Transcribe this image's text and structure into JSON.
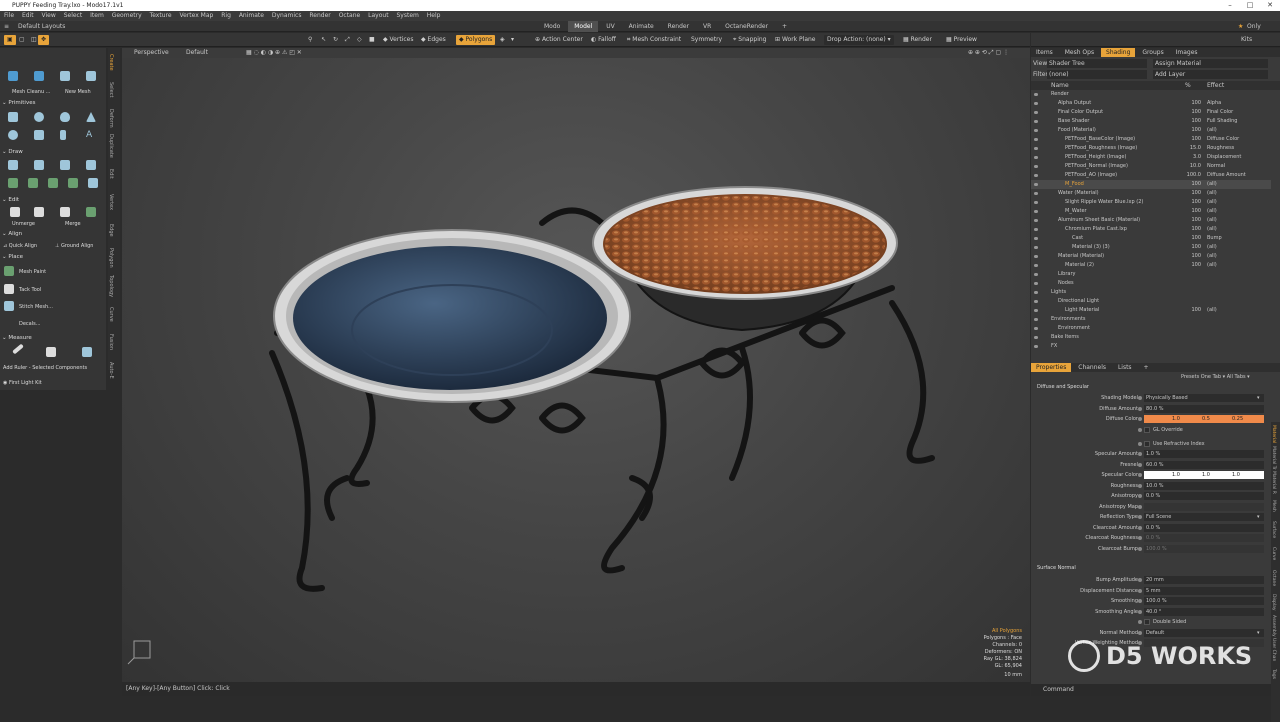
{
  "window": {
    "title": "PUPPY Feeding Tray.lxo - Modo17.1v1"
  },
  "menu": [
    "File",
    "Edit",
    "View",
    "Select",
    "Item",
    "Geometry",
    "Texture",
    "Vertex Map",
    "Rig",
    "Animate",
    "Dynamics",
    "Render",
    "Octane",
    "Layout",
    "System",
    "Help"
  ],
  "layout": {
    "label": "Default Layouts",
    "tabs": [
      "Modo",
      "Model",
      "UV",
      "Animate",
      "Render",
      "VR",
      "OctaneRender"
    ],
    "active_tab": "Model",
    "only_label": "Only",
    "kits_label": "Kits"
  },
  "toolbar": {
    "vertices": "Vertices",
    "edges": "Edges",
    "polygons": "Polygons",
    "action_center": "Action Center",
    "falloff": "Falloff",
    "mesh_constraint": "Mesh Constraint",
    "symmetry": "Symmetry",
    "snapping": "Snapping",
    "work_plane": "Work Plane",
    "drop_action": "Drop Action: (none)",
    "render": "Render",
    "preview": "Preview"
  },
  "left_panel": {
    "mesh_cleanup": "Mesh Cleanu ...",
    "new_mesh": "New Mesh",
    "primitives": "Primitives",
    "draw": "Draw",
    "edit": "Edit",
    "unmerge": "Unmerge",
    "merge": "Merge",
    "align": "Align",
    "quick_align": "Quick Align",
    "ground_align": "Ground Align",
    "place": "Place",
    "mesh_paint": "Mesh Paint",
    "tack_tool": "Tack Tool",
    "stitch_mesh": "Stitch Mesh...",
    "decals": "Decals...",
    "measure": "Measure",
    "add_ruler": "Add Ruler - Selected Components",
    "first_light_kit": "First Light Kit",
    "side_tabs": [
      "Create",
      "Select",
      "Deform",
      "Duplicate",
      "Edit",
      "Vertex",
      "Edge",
      "Polygon",
      "Topology",
      "Curve",
      "Fusion",
      "Auto-E"
    ]
  },
  "viewport": {
    "view": "Perspective",
    "style": "Default",
    "info": [
      "All Polygons",
      "Polygons : Face",
      "Channels: 0",
      "Deformers: ON",
      "Ray GL: 38,824",
      "GL: 65,904",
      "10 mm"
    ]
  },
  "status_bar": {
    "text": "[Any Key]-[Any Button] Click:  Click",
    "command_label": "Command"
  },
  "right_panel": {
    "tabs": [
      "Items",
      "Mesh Ops",
      "Shading",
      "Groups",
      "Images"
    ],
    "active_tab": "Shading",
    "view_label": "View",
    "view_value": "Shader Tree",
    "filter_label": "Filter",
    "filter_value": "(none)",
    "assign_material": "Assign Material",
    "add_layer": "Add Layer",
    "columns": {
      "name": "Name",
      "percent": "%",
      "effect": "Effect"
    },
    "tree": [
      {
        "name": "Render",
        "pct": "",
        "effect": "",
        "indent": 0
      },
      {
        "name": "Alpha Output",
        "pct": "100",
        "effect": "Alpha",
        "indent": 1
      },
      {
        "name": "Final Color Output",
        "pct": "100",
        "effect": "Final Color",
        "indent": 1
      },
      {
        "name": "Base Shader",
        "pct": "100",
        "effect": "Full Shading",
        "indent": 1
      },
      {
        "name": "Food (Material)",
        "pct": "100",
        "effect": "(all)",
        "indent": 1
      },
      {
        "name": "PETFood_BaseColor (Image)",
        "pct": "100",
        "effect": "Diffuse Color",
        "indent": 2
      },
      {
        "name": "PETFood_Roughness (Image)",
        "pct": "15.0",
        "effect": "Roughness",
        "indent": 2
      },
      {
        "name": "PETFood_Height (Image)",
        "pct": "3.0",
        "effect": "Displacement",
        "indent": 2
      },
      {
        "name": "PETFood_Normal (Image)",
        "pct": "10.0",
        "effect": "Normal",
        "indent": 2
      },
      {
        "name": "PETFood_AO (Image)",
        "pct": "100.0",
        "effect": "Diffuse Amount",
        "indent": 2
      },
      {
        "name": "M_Food",
        "pct": "100",
        "effect": "(all)",
        "indent": 2,
        "selected": true
      },
      {
        "name": "Water (Material)",
        "pct": "100",
        "effect": "(all)",
        "indent": 1
      },
      {
        "name": "Slight Ripple Water Blue.lxp (2)",
        "pct": "100",
        "effect": "(all)",
        "indent": 2
      },
      {
        "name": "M_Water",
        "pct": "100",
        "effect": "(all)",
        "indent": 2
      },
      {
        "name": "Aluminum Sheet Basic (Material)",
        "pct": "100",
        "effect": "(all)",
        "indent": 1
      },
      {
        "name": "Chromium Plate Cast.lxp",
        "pct": "100",
        "effect": "(all)",
        "indent": 2
      },
      {
        "name": "Cast",
        "pct": "100",
        "effect": "Bump",
        "indent": 3
      },
      {
        "name": "Material (3) (3)",
        "pct": "100",
        "effect": "(all)",
        "indent": 3
      },
      {
        "name": "Material (Material)",
        "pct": "100",
        "effect": "(all)",
        "indent": 1
      },
      {
        "name": "Material (2)",
        "pct": "100",
        "effect": "(all)",
        "indent": 2
      },
      {
        "name": "Library",
        "pct": "",
        "effect": "",
        "indent": 1
      },
      {
        "name": "Nodes",
        "pct": "",
        "effect": "",
        "indent": 1
      },
      {
        "name": "Lights",
        "pct": "",
        "effect": "",
        "indent": 0
      },
      {
        "name": "Directional Light",
        "pct": "",
        "effect": "",
        "indent": 1
      },
      {
        "name": "Light Material",
        "pct": "100",
        "effect": "(all)",
        "indent": 2
      },
      {
        "name": "Environments",
        "pct": "",
        "effect": "",
        "indent": 0
      },
      {
        "name": "Environment",
        "pct": "",
        "effect": "",
        "indent": 1
      },
      {
        "name": "Bake Items",
        "pct": "",
        "effect": "",
        "indent": 0
      },
      {
        "name": "FX",
        "pct": "",
        "effect": "",
        "indent": 0
      }
    ],
    "props_tabs": [
      "Properties",
      "Channels",
      "Lists"
    ],
    "presets": "Presets",
    "one_tab": "One Tab",
    "all_tabs": "All Tabs",
    "section_diffuse": "Diffuse and Specular",
    "section_surface": "Surface Normal",
    "props": [
      {
        "label": "Shading Model",
        "value": "Physically Based",
        "kind": "select"
      },
      {
        "label": "Diffuse Amount",
        "value": "80.0 %"
      },
      {
        "label": "Diffuse Color",
        "value": "",
        "kind": "color",
        "c": [
          "1.0",
          "0.5",
          "0.25"
        ],
        "bg": "#f08a4a"
      },
      {
        "label": "",
        "value": "GL Override",
        "kind": "check"
      },
      {
        "label": "",
        "value": "Use Refractive Index",
        "kind": "check"
      },
      {
        "label": "Specular Amount",
        "value": "1.0 %"
      },
      {
        "label": "Fresnel",
        "value": "60.0 %"
      },
      {
        "label": "Specular Color",
        "value": "",
        "kind": "color",
        "c": [
          "1.0",
          "1.0",
          "1.0"
        ],
        "bg": "#ffffff"
      },
      {
        "label": "Roughness",
        "value": "10.0 %"
      },
      {
        "label": "Anisotropy",
        "value": "0.0 %"
      },
      {
        "label": "Anisotropy Map",
        "value": "",
        "kind": "dim"
      },
      {
        "label": "Reflection Type",
        "value": "Full Scene",
        "kind": "select"
      },
      {
        "label": "Clearcoat Amount",
        "value": "0.0 %"
      },
      {
        "label": "Clearcoat Roughness",
        "value": "0.0 %",
        "kind": "dim"
      },
      {
        "label": "Clearcoat Bump",
        "value": "100.0 %",
        "kind": "dim"
      }
    ],
    "props2": [
      {
        "label": "Bump Amplitude",
        "value": "20 mm"
      },
      {
        "label": "Displacement Distance",
        "value": "5 mm"
      },
      {
        "label": "Smoothing",
        "value": "100.0 %"
      },
      {
        "label": "Smoothing Angle",
        "value": "40.0 °"
      },
      {
        "label": "",
        "value": "Double Sided",
        "kind": "check"
      },
      {
        "label": "Normal Method",
        "value": "Default",
        "kind": "select"
      },
      {
        "label": "Vertex Weighting Method",
        "value": "",
        "kind": "dim"
      }
    ],
    "side_tabs": [
      "Material",
      "Material Tr",
      "Material R",
      "Mesh",
      "Surface",
      "Curve",
      "Octane",
      "Display",
      "Assembly",
      "User Chan",
      "Tags"
    ]
  },
  "watermark": "D5 WORKS"
}
